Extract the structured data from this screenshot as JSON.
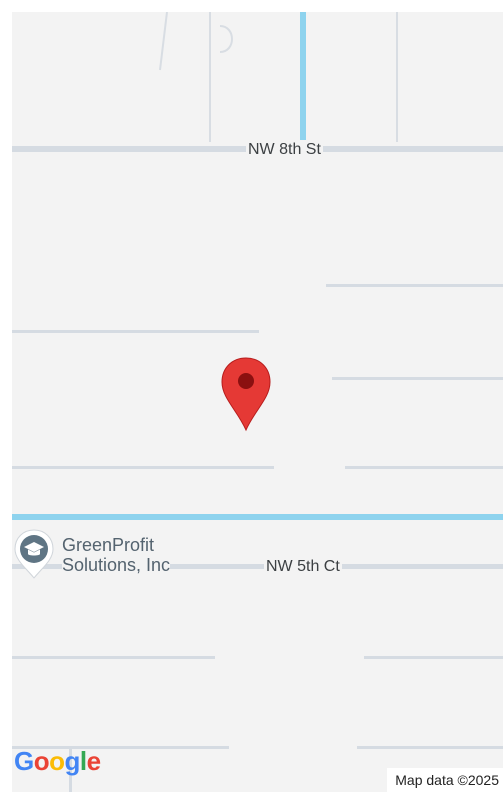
{
  "map": {
    "streets": {
      "north": "NW 8th St",
      "south": "NW 5th Ct"
    },
    "poi": {
      "icon": "graduation-cap-icon",
      "name_line1": "GreenProfit",
      "name_line2": "Solutions, Inc"
    },
    "marker": {
      "icon": "map-pin-icon",
      "color": "#e53935"
    },
    "logo": {
      "text": "Google"
    },
    "attribution": "Map data ©2025"
  },
  "colors": {
    "background": "#f3f3f3",
    "road": "#d5dbe2",
    "water": "#8ed3ee",
    "marker": "#e53935"
  }
}
